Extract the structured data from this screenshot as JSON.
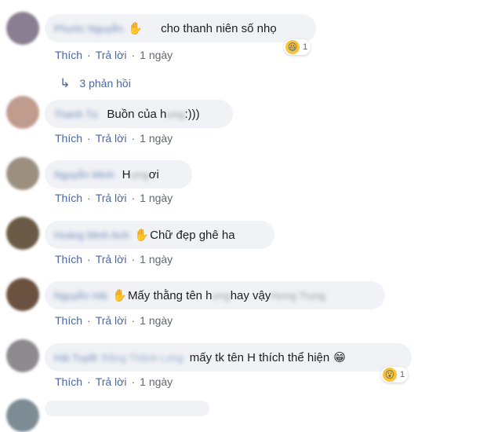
{
  "actions": {
    "like": "Thích",
    "reply": "Trả lời",
    "separator": "·"
  },
  "replies_link": {
    "arrow": "↳",
    "label": "3 phản hồi"
  },
  "comments": [
    {
      "name": "Phước Nguyễn",
      "avatar_color": "#8a7e92",
      "text_before_blur": "",
      "blurred": "",
      "text": "cho thanh niên số nhọ",
      "time": "1 ngày",
      "reaction": {
        "emoji": "😆",
        "count": "1"
      }
    },
    {
      "name": "Thanh Tú",
      "avatar_color": "#c09c8e",
      "text": "Buồn của h",
      "blurred": "ưng",
      "text_after": " :)))",
      "time": "1 ngày"
    },
    {
      "name": "Nguyễn Minh",
      "avatar_color": "#9c8f80",
      "text": "H",
      "blurred": "ưng",
      "text_after": " ơi",
      "time": "1 ngày"
    },
    {
      "name": "Hoàng Minh Anh",
      "avatar_color": "#6a5a46",
      "text": "Chữ đẹp ghê ha",
      "time": "1 ngày"
    },
    {
      "name": "Nguyễn Hải",
      "avatar_color": "#6b5240",
      "text": "Mấy thằng tên h",
      "blurred": "ưng",
      "text_after": " hay vậy ",
      "blurred_tail": "Hưng Trung",
      "time": "1 ngày"
    },
    {
      "name": "Hải Tuyết",
      "name_tail": "Đặng Thành Long",
      "avatar_color": "#8f8a90",
      "text": "mấy tk tên H thích thể hiện",
      "inline_emoji": "😁",
      "time": "1 ngày",
      "reaction": {
        "emoji": "😮",
        "count": "1"
      }
    }
  ]
}
